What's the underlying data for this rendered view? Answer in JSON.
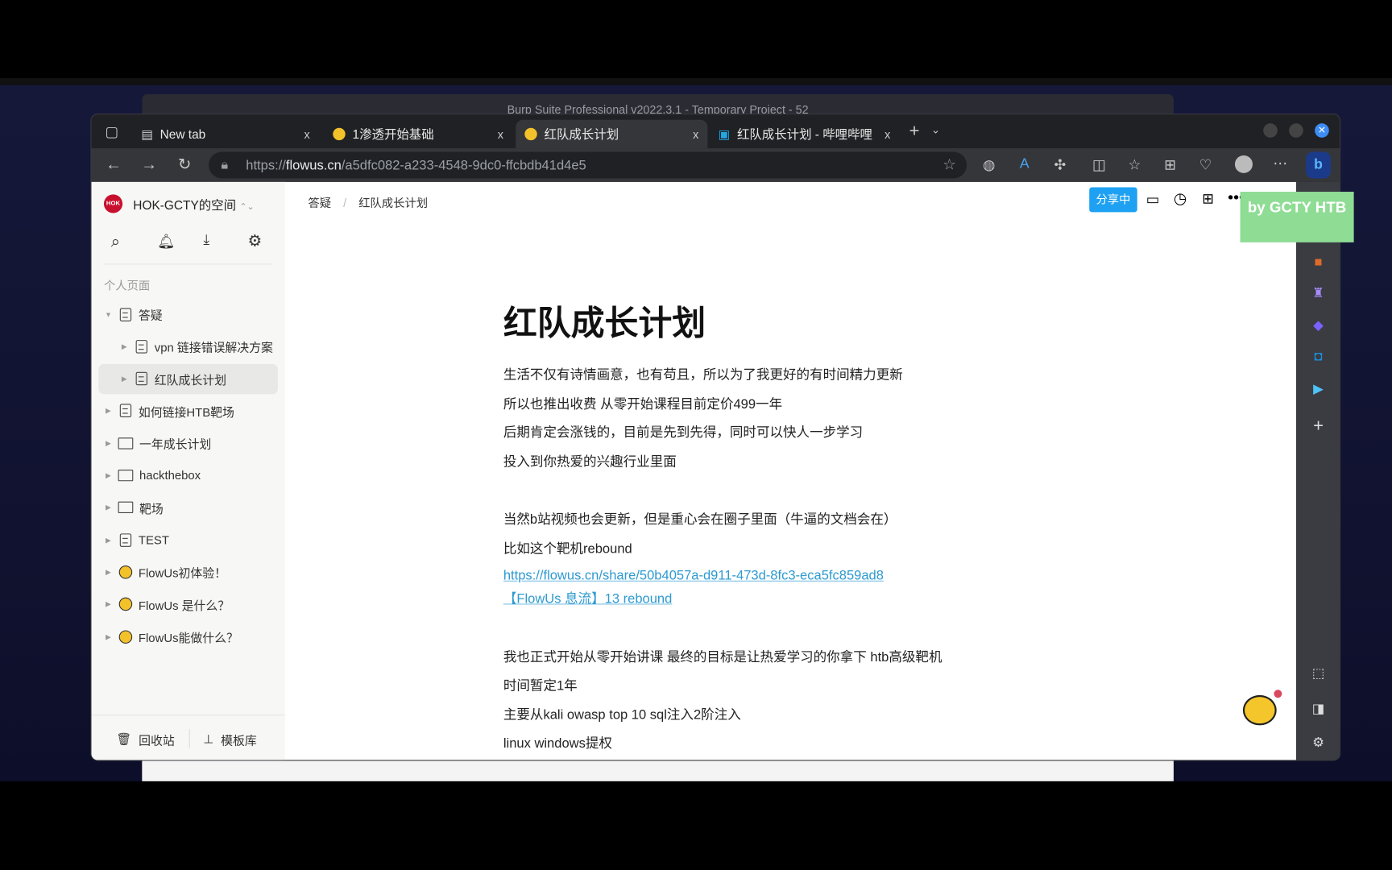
{
  "background_window": {
    "title": "Burp Suite Professional v2022.3.1 - Temporary Project - 52"
  },
  "browser": {
    "tabs": [
      {
        "label": "New tab",
        "active": false
      },
      {
        "label": "1渗透开始基础",
        "active": false
      },
      {
        "label": "红队成长计划",
        "active": true
      },
      {
        "label": "红队成长计划 - 哔哩哔哩",
        "active": false
      }
    ],
    "close_glyph": "x",
    "new_tab_glyph": "+",
    "tab_menu_glyph": "⌄",
    "url_scheme": "https://",
    "url_host": "flowus.cn",
    "url_path": "/a5dfc082-a233-4548-9dc0-ffcbdb41d4e5",
    "toolbar_icons": [
      "globe-p-icon",
      "translate-icon",
      "extensions-icon",
      "split-screen-icon",
      "favorites-icon",
      "collections-icon",
      "performance-icon",
      "profile-icon",
      "more-icon",
      "bing-icon"
    ]
  },
  "sidebar": {
    "workspace": "HOK-GCTY的空间",
    "logo": "HOK",
    "section": "个人页面",
    "items": [
      {
        "label": "答疑",
        "icon": "page",
        "level": 0,
        "expanded": true
      },
      {
        "label": "vpn 链接错误解决方案",
        "icon": "page",
        "level": 1
      },
      {
        "label": "红队成长计划",
        "icon": "page",
        "level": 1,
        "selected": true
      },
      {
        "label": "如何链接HTB靶场",
        "icon": "page",
        "level": 0
      },
      {
        "label": "一年成长计划",
        "icon": "folder",
        "level": 0
      },
      {
        "label": "hackthebox",
        "icon": "folder",
        "level": 0
      },
      {
        "label": "靶场",
        "icon": "folder",
        "level": 0
      },
      {
        "label": "TEST",
        "icon": "page",
        "level": 0
      },
      {
        "label": "FlowUs初体验！",
        "icon": "emoji",
        "level": 0
      },
      {
        "label": "FlowUs 是什么？",
        "icon": "emoji",
        "level": 0
      },
      {
        "label": "FlowUs能做什么？",
        "icon": "emoji",
        "level": 0
      }
    ],
    "trash": "回收站",
    "templates": "模板库"
  },
  "header": {
    "breadcrumb": [
      "答疑",
      "红队成长计划"
    ],
    "separator": "/",
    "share": "分享中",
    "share_color": "#1ea1f2"
  },
  "doc": {
    "title": "红队成长计划",
    "lines": [
      "生活不仅有诗情画意，也有苟且，所以为了我更好的有时间精力更新",
      "所以也推出收费 从零开始课程目前定价499一年",
      "后期肯定会涨钱的，目前是先到先得，同时可以快人一步学习",
      "投入到你热爱的兴趣行业里面"
    ],
    "lines2": [
      "当然b站视频也会更新，但是重心会在圈子里面（牛逼的文档会在）",
      "比如这个靶机rebound"
    ],
    "link1": "https://flowus.cn/share/50b4057a-d911-473d-8fc3-eca5fc859ad8",
    "link2": "【FlowUs 息流】13 rebound",
    "lines3": [
      "我也正式开始从零开始讲课 最终的目标是让热爱学习的你拿下 htb高级靶机",
      "时间暂定1年",
      "主要从kali owasp top 10 sql注入2阶注入",
      "linux windows提权"
    ]
  },
  "watermark": "by GCTY HTB",
  "watermark_color": "#8fdc95"
}
